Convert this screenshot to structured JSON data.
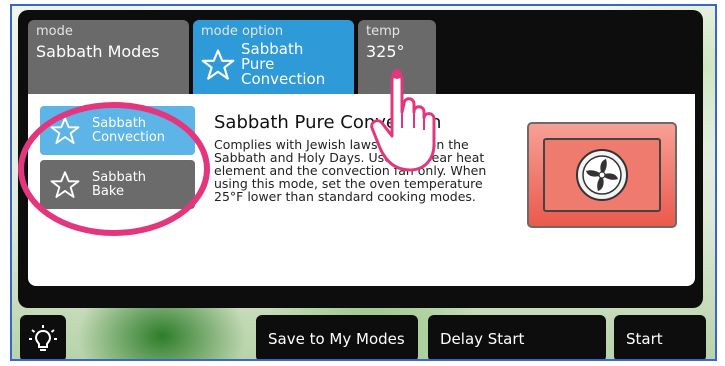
{
  "tabs": {
    "mode": {
      "caption": "mode",
      "value": "Sabbath Modes"
    },
    "mode_option": {
      "caption": "mode option",
      "value_lines": [
        "Sabbath",
        "Pure",
        "Convection"
      ],
      "icon": "star-icon"
    },
    "temp": {
      "caption": "temp",
      "value": "325°"
    }
  },
  "sub_options": [
    {
      "label_lines": [
        "Sabbath",
        "Convection"
      ],
      "icon": "star-icon",
      "selected": true
    },
    {
      "label_lines": [
        "Sabbath",
        "Bake"
      ],
      "icon": "star-icon",
      "selected": false
    }
  ],
  "description": {
    "title": "Sabbath Pure Convection",
    "lines": [
      "Complies with Jewish laws for use on the",
      "Sabbath and Holy Days. Uses the rear heat",
      "element and the convection fan only. When",
      "using this mode, set the oven temperature",
      "25°F lower than standard cooking modes."
    ],
    "illustration_icon": "convection-fan-icon"
  },
  "bottom_bar": {
    "light_icon": "light-bulb-icon",
    "save_label": "Save to My Modes",
    "delay_label": "Delay Start",
    "start_label": "Start"
  },
  "colors": {
    "selected_blue": "#2e9ad8",
    "annotation_pink": "#e4367d",
    "oven_icon_red": "#ea5a4c"
  }
}
